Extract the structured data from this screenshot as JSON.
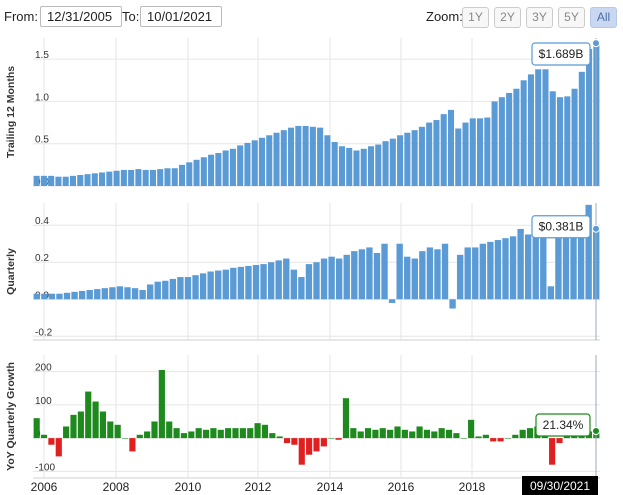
{
  "range": {
    "from_label": "From:",
    "from_value": "12/31/2005",
    "to_label": "To:",
    "to_value": "10/01/2021"
  },
  "zoom": {
    "label": "Zoom:",
    "buttons": [
      "1Y",
      "2Y",
      "3Y",
      "5Y",
      "All"
    ],
    "active": "All"
  },
  "colors": {
    "bar": "#5b9bd5",
    "positive": "#1e8a1e",
    "negative": "#e02020",
    "grid": "#e6e6e6",
    "date_box": "#000000"
  },
  "chart_data": [
    {
      "type": "bar",
      "ylabel": "Trailing 12 Months",
      "ylim": [
        0,
        1.75
      ],
      "yticks": [
        "0.0",
        "0.5",
        "1.0",
        "1.5"
      ],
      "ytick_values": [
        0,
        0.5,
        1.0,
        1.5
      ],
      "tooltip": "$1.689B",
      "values": [
        0.12,
        0.12,
        0.12,
        0.11,
        0.11,
        0.12,
        0.13,
        0.14,
        0.15,
        0.16,
        0.17,
        0.18,
        0.19,
        0.19,
        0.2,
        0.19,
        0.19,
        0.2,
        0.21,
        0.21,
        0.25,
        0.28,
        0.31,
        0.34,
        0.37,
        0.39,
        0.42,
        0.44,
        0.48,
        0.51,
        0.54,
        0.57,
        0.6,
        0.63,
        0.66,
        0.69,
        0.71,
        0.71,
        0.7,
        0.69,
        0.6,
        0.52,
        0.47,
        0.45,
        0.42,
        0.44,
        0.47,
        0.49,
        0.53,
        0.56,
        0.6,
        0.63,
        0.66,
        0.7,
        0.75,
        0.78,
        0.85,
        0.9,
        0.68,
        0.75,
        0.8,
        0.8,
        0.81,
        1.0,
        1.05,
        1.1,
        1.15,
        1.25,
        1.32,
        1.38,
        1.38,
        1.12,
        1.05,
        1.06,
        1.15,
        1.35,
        1.62,
        1.689
      ]
    },
    {
      "type": "bar",
      "ylabel": "Quarterly",
      "ylim": [
        -0.22,
        0.52
      ],
      "yticks": [
        "-0.2",
        "0.0",
        "0.2",
        "0.4"
      ],
      "ytick_values": [
        -0.2,
        0,
        0.2,
        0.4
      ],
      "tooltip": "$0.381B",
      "values": [
        0.03,
        0.03,
        0.03,
        0.03,
        0.035,
        0.04,
        0.045,
        0.05,
        0.055,
        0.06,
        0.065,
        0.07,
        0.065,
        0.06,
        0.05,
        0.08,
        0.095,
        0.1,
        0.11,
        0.12,
        0.12,
        0.13,
        0.14,
        0.15,
        0.155,
        0.16,
        0.17,
        0.175,
        0.18,
        0.185,
        0.19,
        0.2,
        0.21,
        0.22,
        0.16,
        0.12,
        0.19,
        0.2,
        0.22,
        0.23,
        0.22,
        0.24,
        0.26,
        0.27,
        0.28,
        0.25,
        0.3,
        -0.02,
        0.3,
        0.23,
        0.22,
        0.26,
        0.28,
        0.27,
        0.3,
        -0.05,
        0.24,
        0.28,
        0.28,
        0.3,
        0.31,
        0.32,
        0.33,
        0.34,
        0.38,
        0.35,
        0.37,
        0.4,
        0.07,
        0.37,
        0.38,
        0.37,
        0.38,
        0.51,
        0.381
      ]
    },
    {
      "type": "bar",
      "ylabel": "YoY Quarterly Growth",
      "ylim": [
        -120,
        250
      ],
      "yticks": [
        "-100",
        "0",
        "100",
        "200"
      ],
      "ytick_values": [
        -100,
        0,
        100,
        200
      ],
      "tooltip": "21.34%",
      "values": [
        60,
        10,
        -20,
        -55,
        35,
        70,
        80,
        140,
        110,
        80,
        50,
        40,
        0,
        -40,
        10,
        20,
        50,
        205,
        50,
        30,
        15,
        20,
        30,
        25,
        30,
        25,
        30,
        30,
        30,
        30,
        45,
        40,
        15,
        5,
        -15,
        -20,
        -80,
        -50,
        -40,
        -25,
        0,
        -5,
        120,
        30,
        20,
        30,
        25,
        30,
        25,
        35,
        25,
        20,
        35,
        25,
        20,
        30,
        25,
        15,
        0,
        55,
        5,
        10,
        -10,
        -10,
        0,
        10,
        25,
        30,
        35,
        30,
        -80,
        -15,
        10,
        15,
        40,
        20,
        21.34
      ]
    }
  ],
  "x_axis": {
    "labels": [
      "2006",
      "2008",
      "2010",
      "2012",
      "2014",
      "2016",
      "2018"
    ],
    "current_date": "09/30/2021"
  }
}
